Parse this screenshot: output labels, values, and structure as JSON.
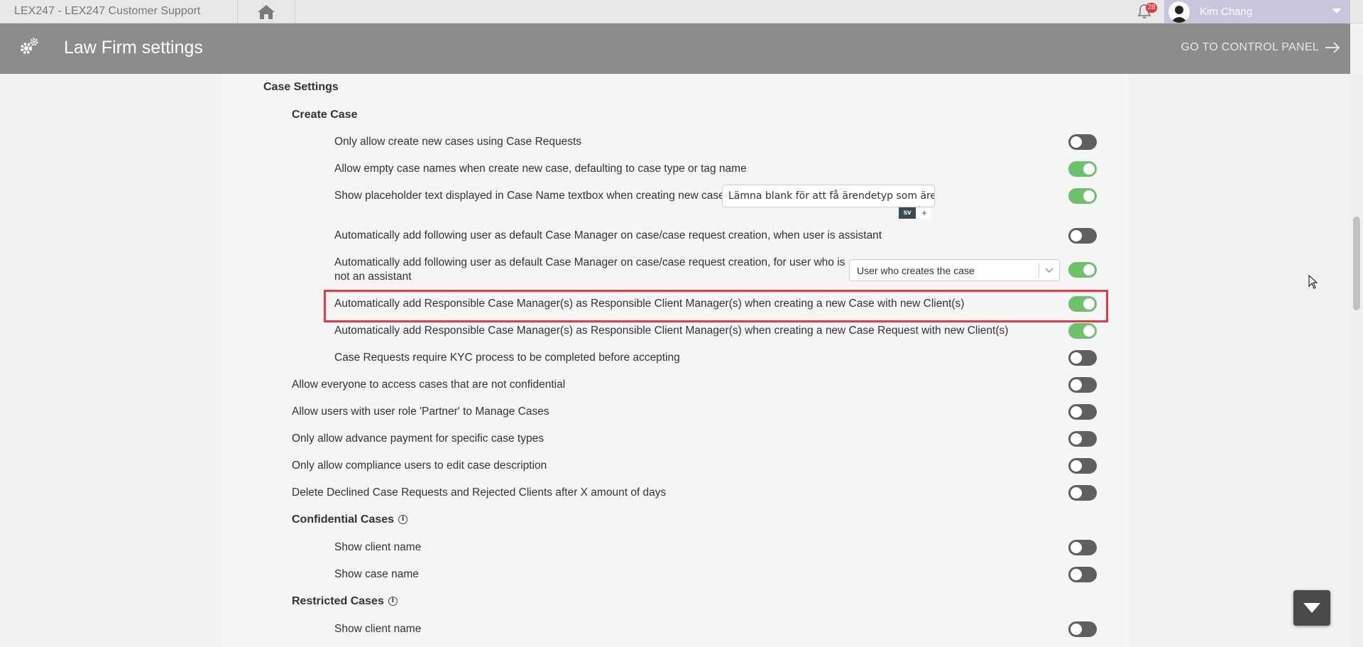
{
  "topbar": {
    "app_title": "LEX247  - LEX247 Customer Support",
    "notification_count": "28",
    "user_name": "Kim Chang"
  },
  "header": {
    "title": "Law Firm settings",
    "control_panel_label": "GO TO CONTROL PANEL"
  },
  "sections": {
    "case_settings": "Case Settings",
    "create_case": "Create Case",
    "confidential_cases": "Confidential Cases",
    "restricted_cases": "Restricted Cases"
  },
  "create_case": {
    "only_case_requests": {
      "label": "Only allow create new cases using Case Requests",
      "enabled": false
    },
    "allow_empty_names": {
      "label": "Allow empty case names when create new case, defaulting to case type or tag name",
      "enabled": true
    },
    "show_placeholder": {
      "label": "Show placeholder text displayed in Case Name textbox when creating new case",
      "value": "Lämna blank för att få ärendetyp som ärende",
      "lang": "sv",
      "add": "+",
      "enabled": true
    },
    "default_manager_assistant": {
      "label": "Automatically add following user as default Case Manager on case/case request creation, when user is assistant",
      "enabled": false
    },
    "default_manager_non_assistant": {
      "label_line1": "Automatically add following user as default Case Manager on case/case request creation, for user who is",
      "label_line2": "not an assistant",
      "select_value": "User who creates the case",
      "enabled": true
    },
    "responsible_client_case": {
      "label": "Automatically add Responsible Case Manager(s) as Responsible Client Manager(s) when creating a new Case with new Client(s)",
      "enabled": true
    },
    "responsible_client_case_request": {
      "label": "Automatically add Responsible Case Manager(s) as Responsible Client Manager(s) when creating a new Case Request with new Client(s)",
      "enabled": true
    },
    "kyc_required": {
      "label": "Case Requests require KYC process to be completed before accepting",
      "enabled": false
    }
  },
  "general": {
    "everyone_access": {
      "label": "Allow everyone to access cases that are not confidential",
      "enabled": false
    },
    "partner_manage": {
      "label": "Allow users with user role 'Partner' to Manage Cases",
      "enabled": false
    },
    "advance_payment": {
      "label": "Only allow advance payment for specific case types",
      "enabled": false
    },
    "compliance_edit": {
      "label": "Only allow compliance users to edit case description",
      "enabled": false
    },
    "delete_declined": {
      "label": "Delete Declined Case Requests and Rejected Clients after X amount of days",
      "enabled": false
    }
  },
  "confidential": {
    "show_client_name": {
      "label": "Show client name",
      "enabled": false
    },
    "show_case_name": {
      "label": "Show case name",
      "enabled": false
    }
  },
  "restricted": {
    "show_client_name": {
      "label": "Show client name",
      "enabled": false
    }
  },
  "colors": {
    "toggle_on": "#6cc26a",
    "toggle_off": "#5f5f5f",
    "highlight": "#e53945",
    "header_bg": "#8c8c8c"
  }
}
